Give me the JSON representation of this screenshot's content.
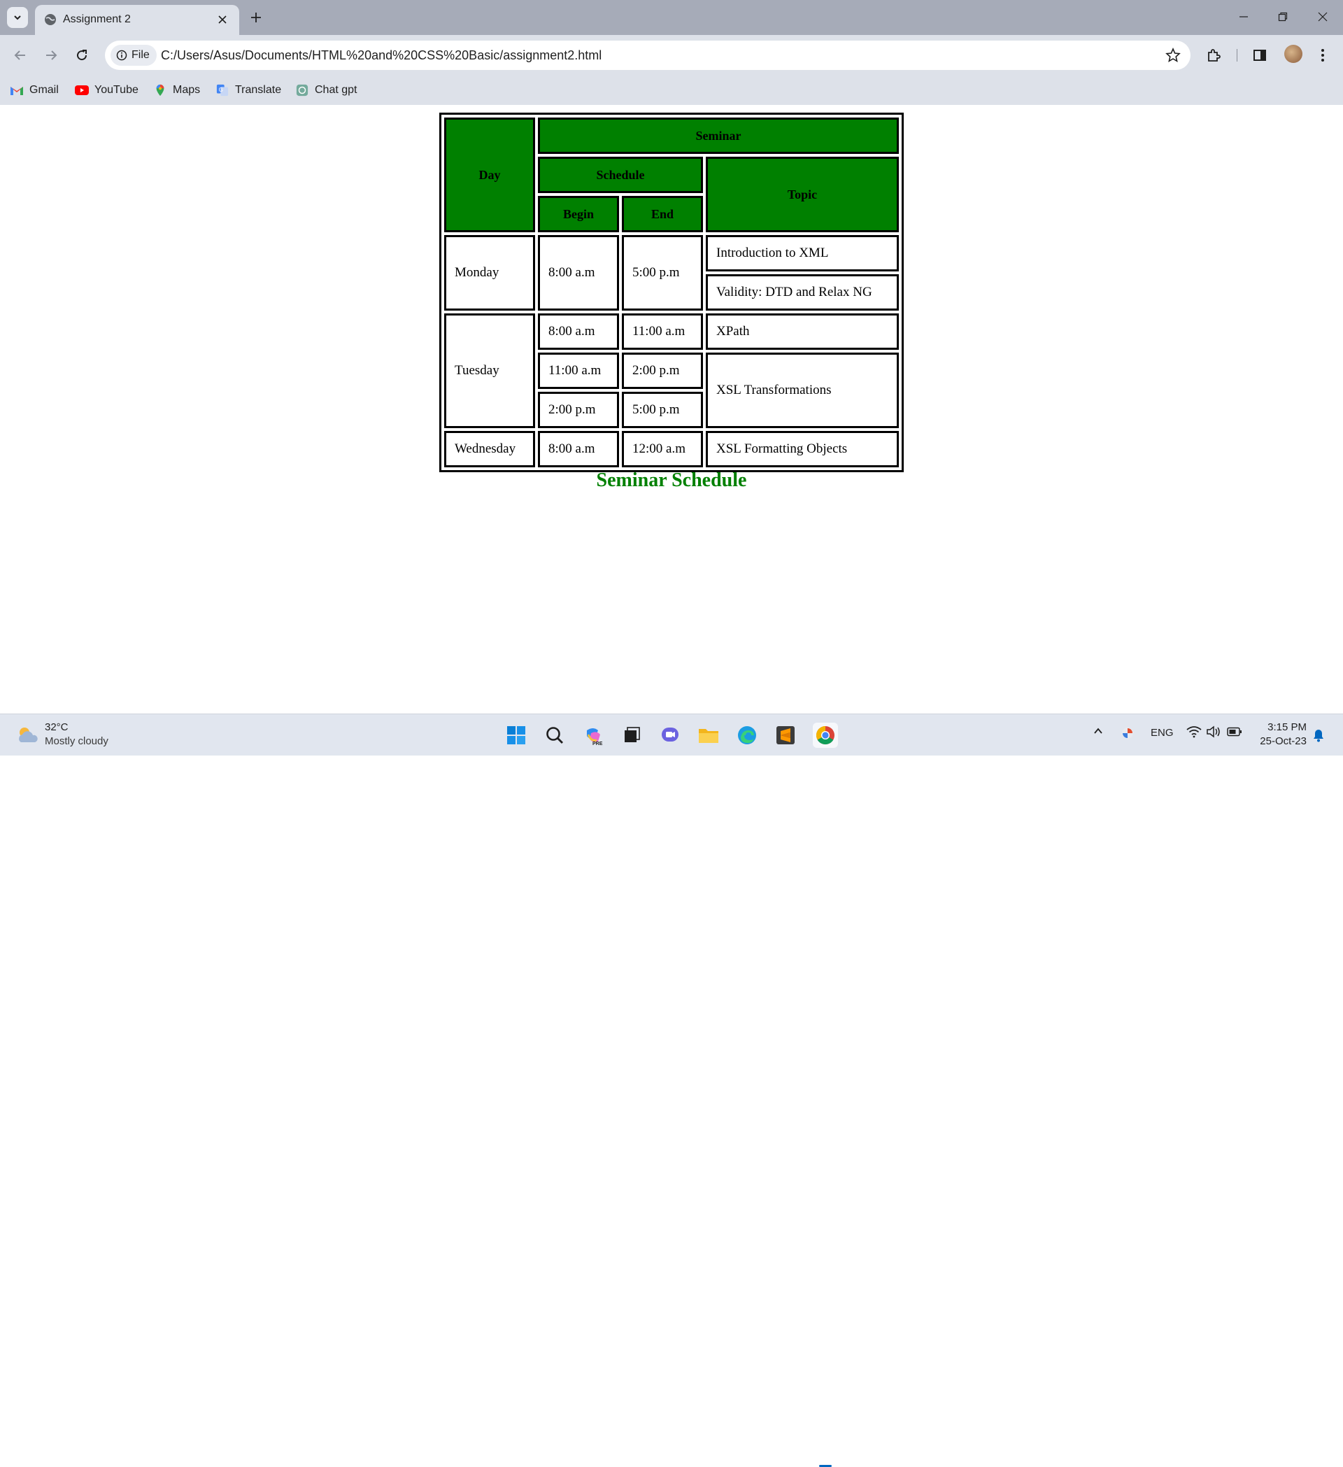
{
  "browser": {
    "tab_title": "Assignment 2",
    "file_chip_label": "File",
    "url": "C:/Users/Asus/Documents/HTML%20and%20CSS%20Basic/assignment2.html",
    "bookmarks": [
      "Gmail",
      "YouTube",
      "Maps",
      "Translate",
      "Chat gpt"
    ]
  },
  "table": {
    "headers": {
      "day": "Day",
      "seminar": "Seminar",
      "schedule": "Schedule",
      "topic": "Topic",
      "begin": "Begin",
      "end": "End"
    },
    "rows": {
      "monday": {
        "day": "Monday",
        "begin": "8:00 a.m",
        "end": "5:00 p.m",
        "topics": [
          "Introduction to XML",
          "Validity: DTD and Relax NG"
        ]
      },
      "tuesday": {
        "day": "Tuesday",
        "slots": [
          {
            "begin": "8:00 a.m",
            "end": "11:00 a.m",
            "topic": "XPath"
          },
          {
            "begin": "11:00 a.m",
            "end": "2:00 p.m",
            "topic": "XSL Transformations"
          },
          {
            "begin": "2:00 p.m",
            "end": "5:00 p.m"
          }
        ]
      },
      "wednesday": {
        "day": "Wednesday",
        "begin": "8:00 a.m",
        "end": "12:00 a.m",
        "topic": "XSL Formatting Objects"
      }
    },
    "caption": "Seminar Schedule"
  },
  "taskbar": {
    "weather_temp": "32°C",
    "weather_desc": "Mostly cloudy",
    "language": "ENG",
    "time": "3:15 PM",
    "date": "25-Oct-23"
  },
  "colors": {
    "header_green": "#008000",
    "chrome_frame": "#a6abb8",
    "chrome_toolbar": "#dde1e9"
  }
}
